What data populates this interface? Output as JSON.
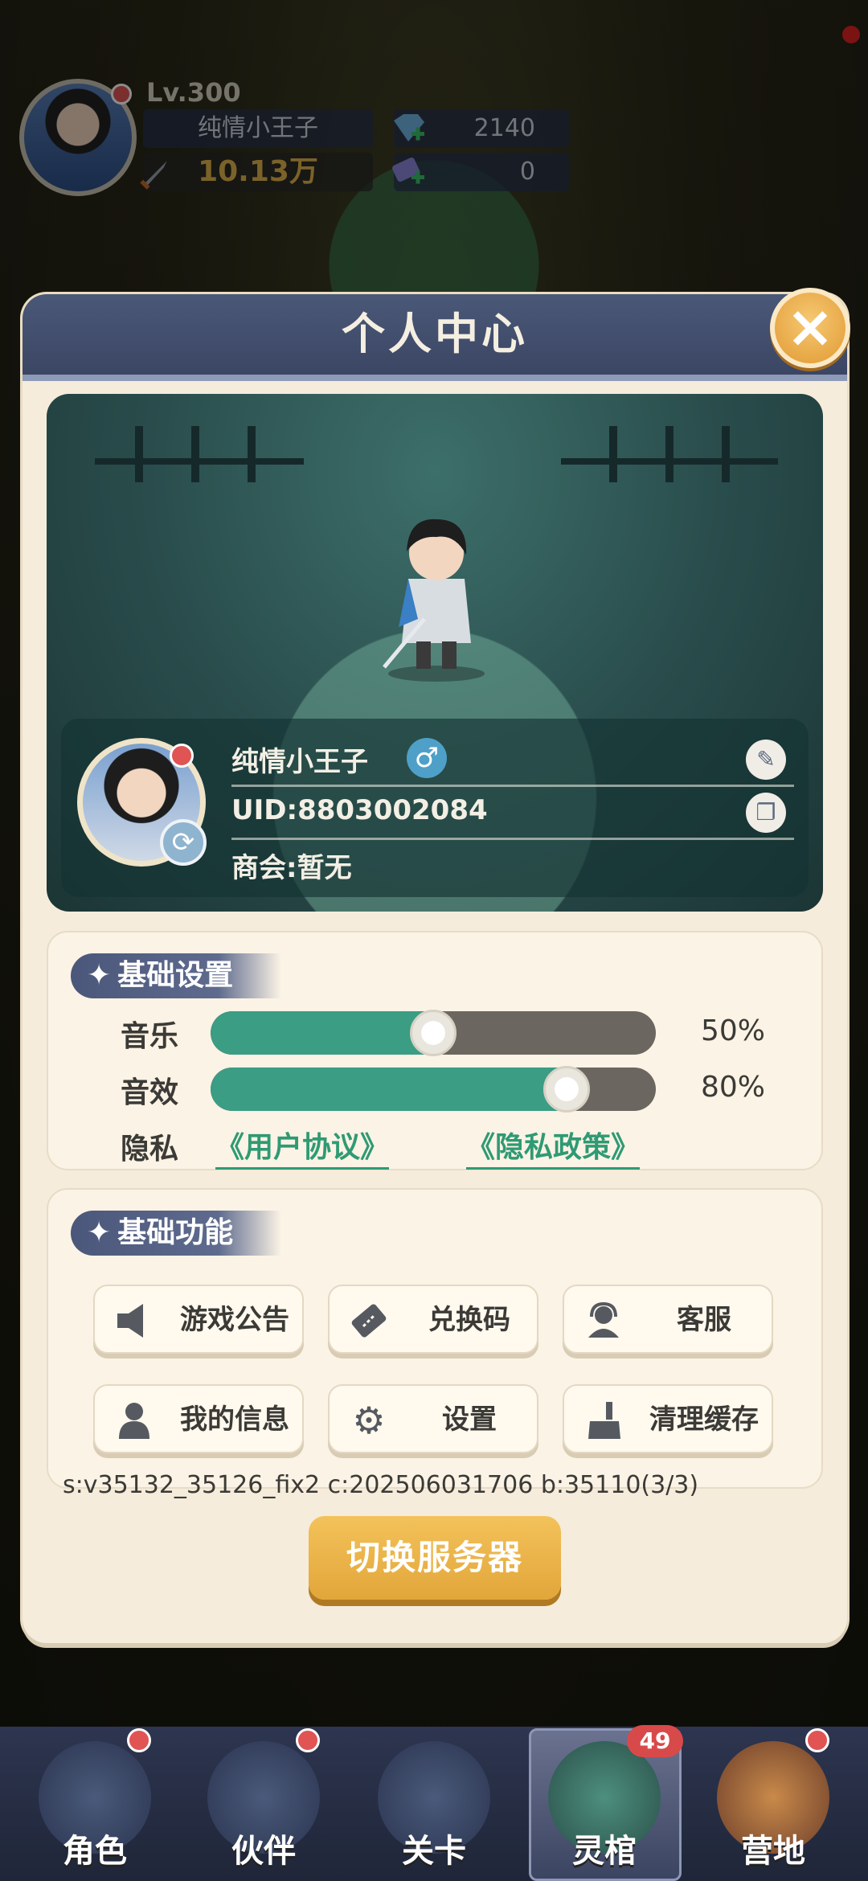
{
  "hud": {
    "level": "Lv.300",
    "player_name": "纯情小王子",
    "power": "10.13万",
    "gems": "2140",
    "tickets": "0"
  },
  "panel": {
    "title": "个人中心",
    "close_icon": "×"
  },
  "profile": {
    "name": "纯情小王子",
    "gender_icon": "♂",
    "uid": "UID:8803002084",
    "guild": "商会:暂无",
    "edit_icon": "✎",
    "copy_icon": "❐",
    "swap_icon": "⟳"
  },
  "basic_settings": {
    "title": "基础设置",
    "music_label": "音乐",
    "music_value": "50%",
    "music_level": 50,
    "sfx_label": "音效",
    "sfx_value": "80%",
    "sfx_level": 80,
    "privacy_label": "隐私",
    "user_agreement": "《用户协议》",
    "privacy_policy": "《隐私政策》"
  },
  "basic_functions": {
    "title": "基础功能",
    "buttons": [
      {
        "label": "游戏公告",
        "icon": "speaker-icon"
      },
      {
        "label": "兑换码",
        "icon": "ticket-icon"
      },
      {
        "label": "客服",
        "icon": "headset-icon"
      },
      {
        "label": "我的信息",
        "icon": "person-icon"
      },
      {
        "label": "设置",
        "icon": "gear-icon"
      },
      {
        "label": "清理缓存",
        "icon": "broom-icon"
      }
    ]
  },
  "version_text": "s:v35132_35126_fix2 c:202506031706 b:35110(3/3)",
  "switch_server_label": "切换服务器",
  "bottom_nav": {
    "items": [
      {
        "label": "角色"
      },
      {
        "label": "伙伴"
      },
      {
        "label": "关卡"
      },
      {
        "label": "灵棺"
      },
      {
        "label": "营地"
      }
    ],
    "badge": "49"
  }
}
